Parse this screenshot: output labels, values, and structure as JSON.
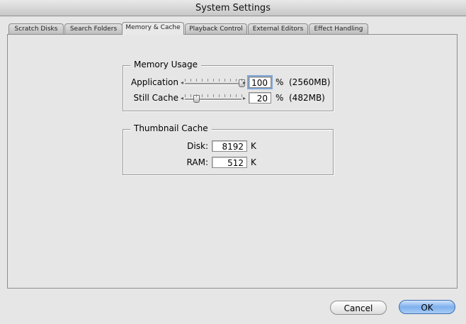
{
  "window": {
    "title": "System Settings"
  },
  "tabs": [
    {
      "label": "Scratch Disks",
      "active": false
    },
    {
      "label": "Search Folders",
      "active": false
    },
    {
      "label": "Memory & Cache",
      "active": true
    },
    {
      "label": "Playback Control",
      "active": false
    },
    {
      "label": "External Editors",
      "active": false
    },
    {
      "label": "Effect Handling",
      "active": false
    }
  ],
  "memory_usage": {
    "title": "Memory Usage",
    "application": {
      "label": "Application",
      "value": "100",
      "unit": "%",
      "detail": "(2560MB)",
      "slider_fraction": 1.0
    },
    "still_cache": {
      "label": "Still Cache",
      "value": "20",
      "unit": "%",
      "detail": "(482MB)",
      "slider_fraction": 0.2
    }
  },
  "thumbnail_cache": {
    "title": "Thumbnail Cache",
    "disk": {
      "label": "Disk:",
      "value": "8192",
      "unit": "K"
    },
    "ram": {
      "label": "RAM:",
      "value": "512",
      "unit": "K"
    }
  },
  "buttons": {
    "cancel": "Cancel",
    "ok": "OK"
  },
  "icons": {
    "slider_left": "◂",
    "slider_right": "▸"
  }
}
